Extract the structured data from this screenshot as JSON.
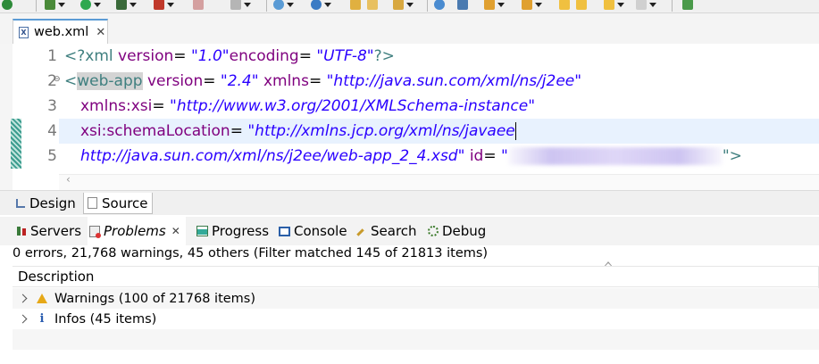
{
  "editor": {
    "tab_title": "web.xml",
    "line_numbers": [
      "1",
      "2",
      "3",
      "4",
      "5"
    ],
    "lines": {
      "l1": {
        "open": "<?xml ",
        "a1": "version",
        "eq1": "=",
        "v1": "\"1.0\"",
        "a2": "encoding",
        "eq2": "=",
        "v2": "\"UTF-8\"",
        "close": "?>"
      },
      "l2": {
        "lt": "<",
        "tag": "web-app",
        "a1": " version",
        "eq1": "=",
        "v1": "\"2.4\"",
        "a2": " xmlns",
        "eq2": "=",
        "v2": "\"http://java.sun.com/xml/ns/j2ee\""
      },
      "l3": {
        "a1": "xmlns:xsi",
        "eq1": "=",
        "v1": "\"http://www.w3.org/2001/XMLSchema-instance\""
      },
      "l4": {
        "a1": "xsi:schemaLocation",
        "eq1": "=",
        "v1": "\"http://xmlns.jcp.org/xml/ns/javaee"
      },
      "l5": {
        "v0": "http://java.sun.com/xml/ns/j2ee/web-app_2_4.xsd\"",
        "a1": " id",
        "eq1": "=",
        "v1": "\"",
        "close": "\">"
      }
    }
  },
  "mode_tabs": {
    "design": "Design",
    "source": "Source"
  },
  "panel": {
    "tabs": [
      "Servers",
      "Problems",
      "Progress",
      "Console",
      "Search",
      "Debug"
    ],
    "summary": "0 errors, 21,768 warnings, 45 others (Filter matched 145 of 21813 items)",
    "column_header": "Description",
    "rows": [
      {
        "label": "Warnings (100 of 21768 items)",
        "icon": "warning-icon"
      },
      {
        "label": "Infos (45 items)",
        "icon": "info-icon"
      }
    ]
  },
  "colors": {
    "tag": "#3f7f7f",
    "attribute": "#7f007f",
    "value": "#2a00ff",
    "current_line": "#e8f2fe",
    "active_tab_border": "#5b9bd5"
  }
}
